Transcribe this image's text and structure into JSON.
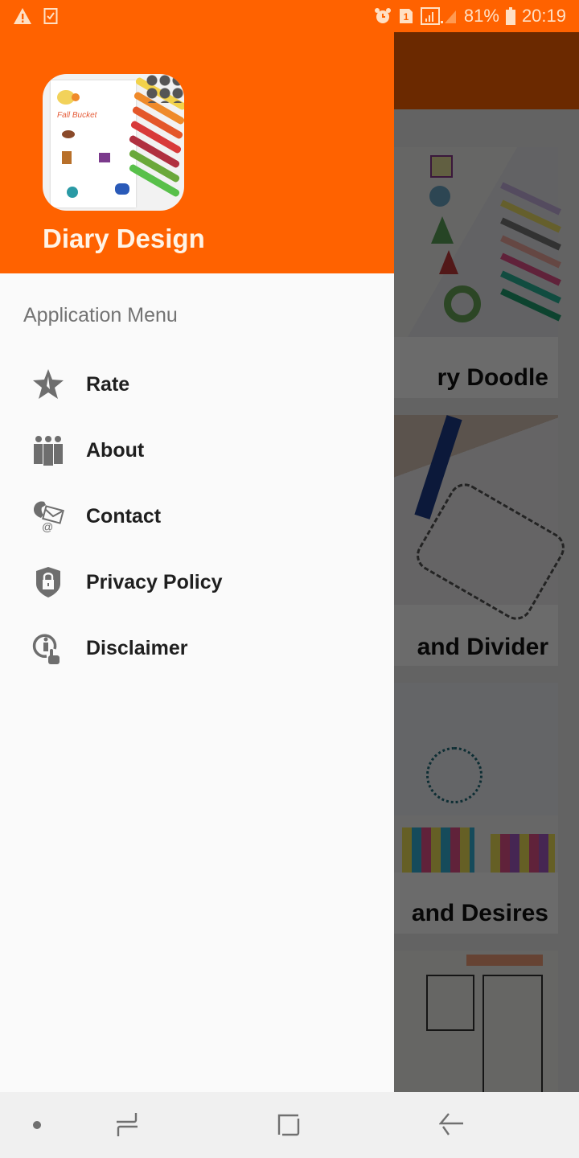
{
  "status_bar": {
    "left_icons": [
      "warning-icon",
      "task-check-icon"
    ],
    "right_icons": [
      "alarm-icon",
      "sim-1-icon",
      "signal-icon"
    ],
    "battery": "81%",
    "time": "20:19"
  },
  "drawer": {
    "app_title": "Diary Design",
    "section_header": "Application Menu",
    "items": [
      {
        "label": "Rate",
        "icon": "star-icon"
      },
      {
        "label": "About",
        "icon": "people-icon"
      },
      {
        "label": "Contact",
        "icon": "contact-phone-mail-icon"
      },
      {
        "label": "Privacy Policy",
        "icon": "shield-lock-icon"
      },
      {
        "label": "Disclaimer",
        "icon": "info-touch-icon"
      }
    ]
  },
  "background": {
    "cards": [
      {
        "title": "ry Doodle"
      },
      {
        "title": "and Divider"
      },
      {
        "title": "and Desires"
      },
      {
        "title": ""
      }
    ]
  },
  "nav_bar": {
    "buttons": [
      "dot-indicator",
      "recent-apps",
      "home",
      "back"
    ]
  },
  "colors": {
    "brand": "#ff6200",
    "drawer_bg": "#fafafa",
    "icon_gray": "#6e6e6e",
    "label_dark": "#1f1f1f",
    "section_gray": "#737373"
  }
}
